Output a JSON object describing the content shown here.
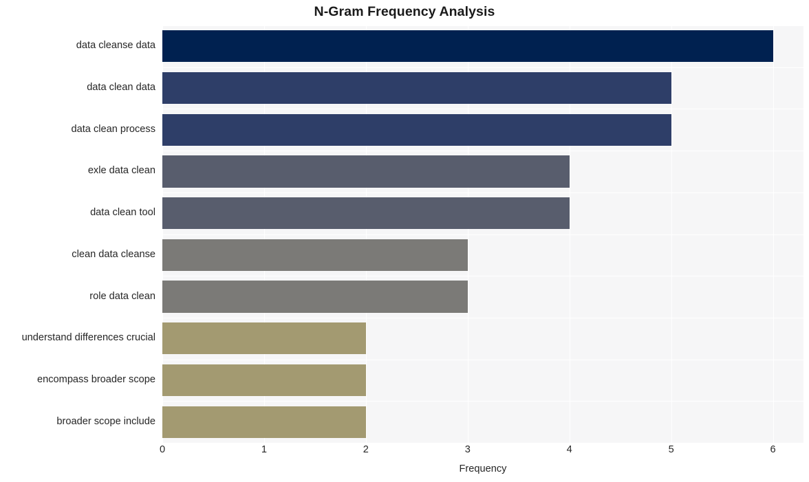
{
  "chart_data": {
    "type": "bar",
    "orientation": "horizontal",
    "title": "N-Gram Frequency Analysis",
    "xlabel": "Frequency",
    "ylabel": "",
    "categories": [
      "data cleanse data",
      "data clean data",
      "data clean process",
      "exle data clean",
      "data clean tool",
      "clean data cleanse",
      "role data clean",
      "understand differences crucial",
      "encompass broader scope",
      "broader scope include"
    ],
    "values": [
      6,
      5,
      5,
      4,
      4,
      3,
      3,
      2,
      2,
      2
    ],
    "bar_colors": [
      "#002150",
      "#2e3e68",
      "#2e3e68",
      "#585d6d",
      "#585d6d",
      "#7b7a77",
      "#7b7a77",
      "#a39a71",
      "#a39a71",
      "#a39a71"
    ],
    "xlim": [
      0,
      6.3
    ],
    "xticks": [
      0,
      1,
      2,
      3,
      4,
      5,
      6
    ],
    "xtick_labels": [
      "0",
      "1",
      "2",
      "3",
      "4",
      "5",
      "6"
    ],
    "grid": true,
    "grid_color": "#ffffff",
    "plot_background": "#f6f6f7",
    "figure_background": "#ffffff",
    "legend": "none"
  }
}
